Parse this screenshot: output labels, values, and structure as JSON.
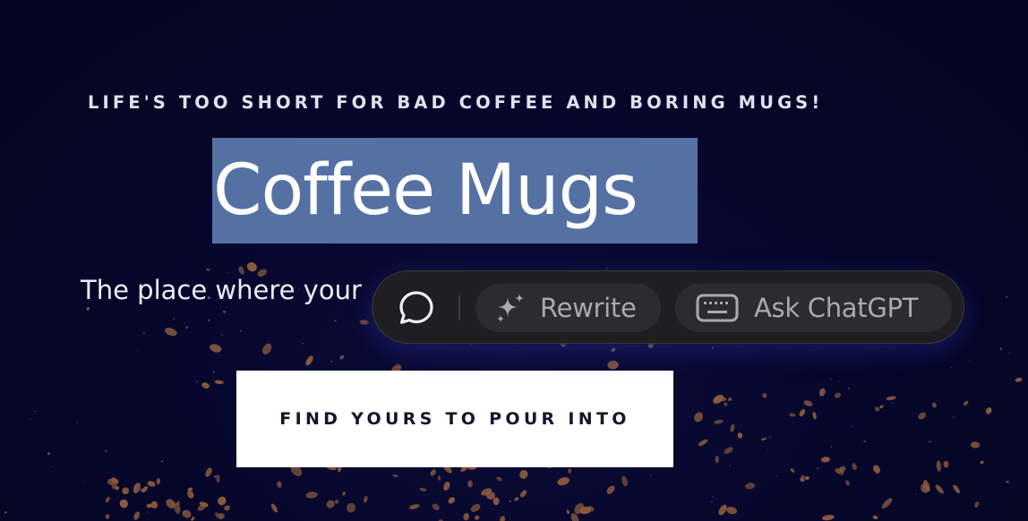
{
  "hero": {
    "tagline": "LIFE'S TOO SHORT FOR BAD COFFEE AND BORING MUGS!",
    "title": "Coffee Mugs",
    "subtitle": "The place where your",
    "cta_label": "FIND YOURS TO POUR INTO"
  },
  "ai_toolbar": {
    "chat_icon": "speech-bubble-icon",
    "rewrite_icon": "sparkles-icon",
    "rewrite_label": "Rewrite",
    "ask_icon": "keyboard-icon",
    "ask_label": "Ask ChatGPT"
  },
  "colors": {
    "background": "#06062a",
    "selection_highlight": "#5571a4",
    "cta_background": "#ffffff",
    "toolbar_background": "#1f1f22",
    "coffee_bean": "#8a5a3c"
  }
}
